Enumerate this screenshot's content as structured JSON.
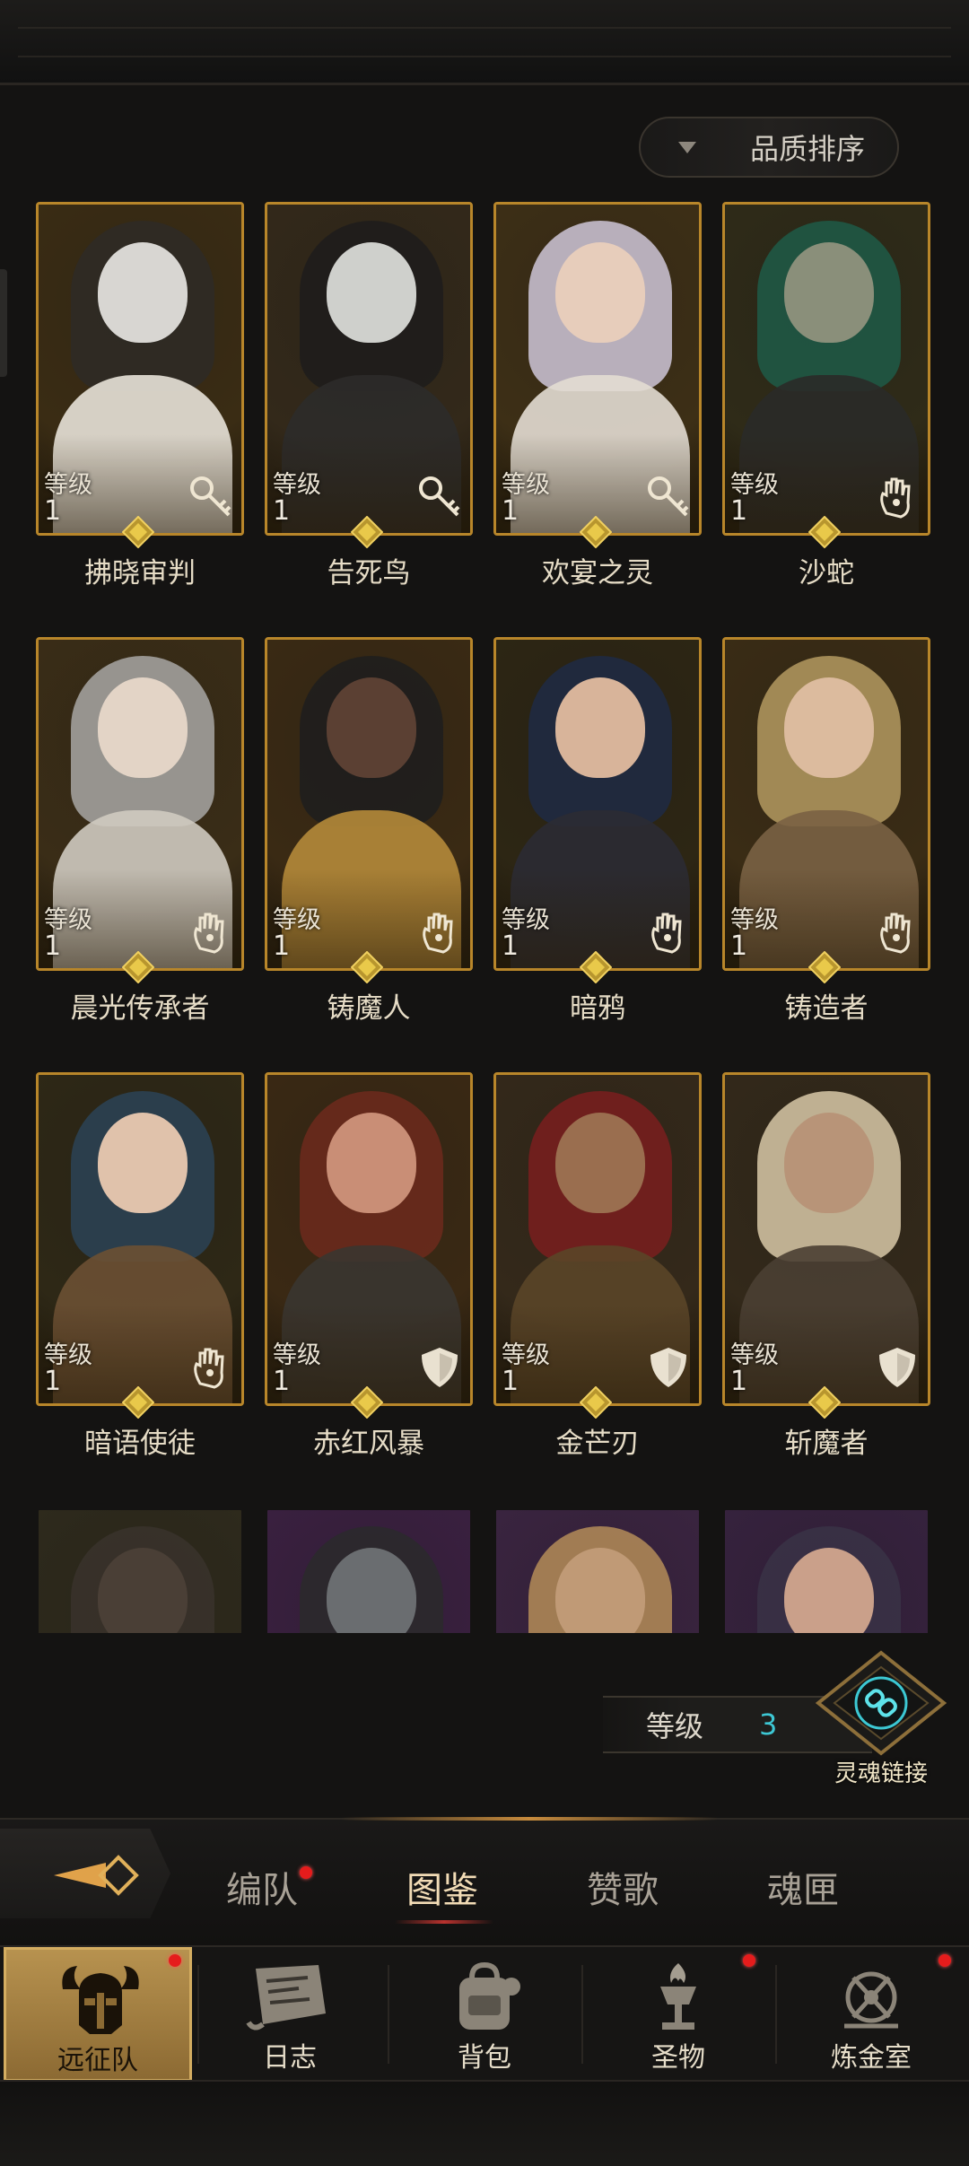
{
  "sort_button": {
    "label": "品质排序",
    "icon": "dropdown-triangle-icon"
  },
  "heroes": [
    {
      "name": "拂晓审判",
      "level_label": "等级",
      "level": "1",
      "class_icon": "key-icon",
      "palette": [
        "#3a2c14",
        "#d8d6d2",
        "#2e2a26",
        "#e8e2d8"
      ]
    },
    {
      "name": "告死鸟",
      "level_label": "等级",
      "level": "1",
      "class_icon": "key-icon",
      "palette": [
        "#33291a",
        "#cfd0cc",
        "#1d1c1c",
        "#2c2b2a"
      ]
    },
    {
      "name": "欢宴之灵",
      "level_label": "等级",
      "level": "1",
      "class_icon": "key-icon",
      "palette": [
        "#3d2f16",
        "#e7cdbb",
        "#cfc7d8",
        "#e3ddd3"
      ]
    },
    {
      "name": "沙蛇",
      "level_label": "等级",
      "level": "1",
      "class_icon": "palm-icon",
      "palette": [
        "#2f2b18",
        "#8a8f7a",
        "#1f5a48",
        "#2a2a28"
      ]
    },
    {
      "name": "晨光传承者",
      "level_label": "等级",
      "level": "1",
      "class_icon": "palm-icon",
      "palette": [
        "#3a2d17",
        "#e3d4c6",
        "#a8a7a4",
        "#cfcac0"
      ]
    },
    {
      "name": "铸魔人",
      "level_label": "等级",
      "level": "1",
      "class_icon": "palm-icon",
      "palette": [
        "#3a2a14",
        "#5b4033",
        "#1d1d1d",
        "#b58a3a"
      ]
    },
    {
      "name": "暗鸦",
      "level_label": "等级",
      "level": "1",
      "class_icon": "palm-icon",
      "palette": [
        "#2d2614",
        "#d8b49a",
        "#1f2a44",
        "#2b2b33"
      ]
    },
    {
      "name": "铸造者",
      "level_label": "等级",
      "level": "1",
      "class_icon": "palm-icon",
      "palette": [
        "#3a2c15",
        "#dcbb9e",
        "#b49a60",
        "#7a6244"
      ]
    },
    {
      "name": "暗语使徒",
      "level_label": "等级",
      "level": "1",
      "class_icon": "palm-icon",
      "palette": [
        "#2e2816",
        "#e0c2ab",
        "#2c4356",
        "#6b5033"
      ]
    },
    {
      "name": "赤红风暴",
      "level_label": "等级",
      "level": "1",
      "class_icon": "shield-icon",
      "palette": [
        "#3a2914",
        "#c98e76",
        "#6d2a1c",
        "#3a3530"
      ]
    },
    {
      "name": "金芒刃",
      "level_label": "等级",
      "level": "1",
      "class_icon": "shield-icon",
      "palette": [
        "#34291a",
        "#9a6e4f",
        "#7a1f1f",
        "#5a4528"
      ]
    },
    {
      "name": "斩魔者",
      "level_label": "等级",
      "level": "1",
      "class_icon": "shield-icon",
      "palette": [
        "#33291a",
        "#b89478",
        "#d8c9a8",
        "#4a3f33"
      ]
    },
    {
      "name": "",
      "level_label": "",
      "level": "",
      "class_icon": "",
      "palette": [
        "#2e2a1c",
        "#4a3f36",
        "#3a332c",
        "#1f1d1b"
      ]
    },
    {
      "name": "",
      "level_label": "",
      "level": "",
      "class_icon": "",
      "palette": [
        "#3a2040",
        "#6a6d70",
        "#2a2a2c",
        "#1e1d1f"
      ]
    },
    {
      "name": "",
      "level_label": "",
      "level": "",
      "class_icon": "",
      "palette": [
        "#3a2440",
        "#c09a76",
        "#b48c58",
        "#2a2520"
      ]
    },
    {
      "name": "",
      "level_label": "",
      "level": "",
      "class_icon": "",
      "palette": [
        "#36223e",
        "#caa08a",
        "#3a3246",
        "#221e24"
      ]
    }
  ],
  "level_bar": {
    "label": "等级",
    "value": "3"
  },
  "soul_link": {
    "label": "灵魂链接",
    "icon": "chain-link-icon"
  },
  "sub_tabs": [
    {
      "label": "编队",
      "has_dot": true
    },
    {
      "label": "图鉴",
      "has_dot": false,
      "active": true
    },
    {
      "label": "赞歌",
      "has_dot": false
    },
    {
      "label": "魂匣",
      "has_dot": false
    }
  ],
  "bottom_nav": [
    {
      "label": "远征队",
      "icon": "horned-helmet-icon",
      "active": true,
      "has_dot": true
    },
    {
      "label": "日志",
      "icon": "scroll-map-icon",
      "has_dot": false
    },
    {
      "label": "背包",
      "icon": "backpack-icon",
      "has_dot": false
    },
    {
      "label": "圣物",
      "icon": "torch-chalice-icon",
      "has_dot": true
    },
    {
      "label": "炼金室",
      "icon": "alchemy-icon",
      "has_dot": true
    }
  ],
  "colors": {
    "accent_gold": "#b8862a",
    "level_value": "#3dc7d4",
    "notification": "#e51c1c"
  }
}
